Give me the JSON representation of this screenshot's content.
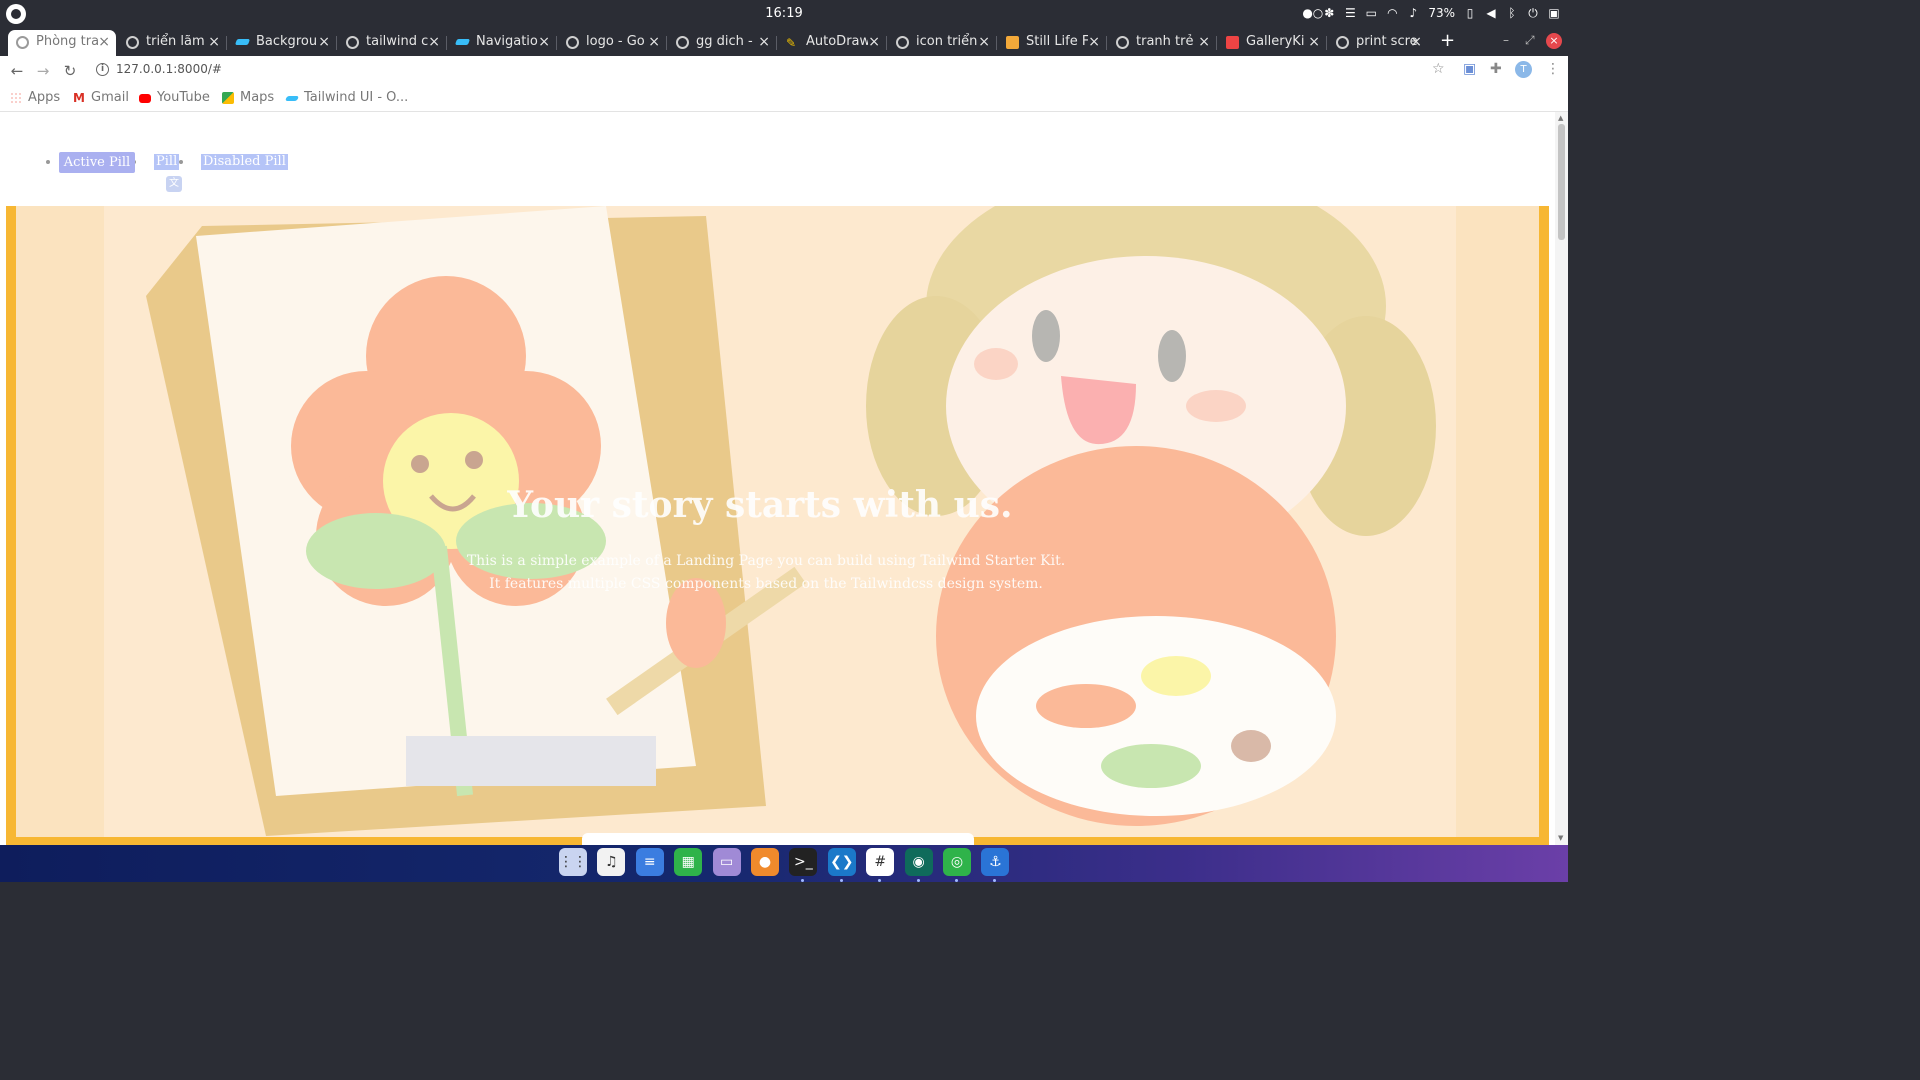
{
  "system_bar": {
    "clock": "16:19",
    "battery": "73%"
  },
  "tabs": [
    {
      "title": "Phòng tra",
      "active": true
    },
    {
      "title": "triển lãm",
      "active": false
    },
    {
      "title": "Backgrou",
      "active": false
    },
    {
      "title": "tailwind c",
      "active": false
    },
    {
      "title": "Navigatio",
      "active": false
    },
    {
      "title": "logo - Go",
      "active": false
    },
    {
      "title": "gg dich - ",
      "active": false
    },
    {
      "title": "AutoDraw",
      "active": false
    },
    {
      "title": "icon triển",
      "active": false
    },
    {
      "title": "Still Life F",
      "active": false
    },
    {
      "title": "tranh trẻ",
      "active": false
    },
    {
      "title": "GalleryKi",
      "active": false
    },
    {
      "title": "print scre",
      "active": false
    }
  ],
  "toolbar": {
    "url": "127.0.0.1:8000/#",
    "profile_initial": "T"
  },
  "bookmarks": [
    {
      "label": "Apps",
      "icon": "apps-grid-icon"
    },
    {
      "label": "Gmail",
      "icon": "gmail-icon"
    },
    {
      "label": "YouTube",
      "icon": "youtube-icon"
    },
    {
      "label": "Maps",
      "icon": "maps-icon"
    },
    {
      "label": "Tailwind UI - O...",
      "icon": "tailwind-icon"
    }
  ],
  "pills": {
    "active": "Active Pill",
    "plain": "Pill",
    "disabled": "Disabled Pill"
  },
  "hero": {
    "title": "Your story starts with us.",
    "text_line1": "This is a simple example of a Landing Page you can build using Tailwind Starter Kit. It features",
    "text_line2": "multiple CSS components based on the Tailwindcss design system.",
    "accent_color": "#f7b733"
  },
  "dock": [
    {
      "name": "app-grid-icon",
      "color": "#c9d4f0",
      "glyph": "⋮⋮"
    },
    {
      "name": "music-icon",
      "color": "#f2f2f2",
      "glyph": "♫"
    },
    {
      "name": "text-editor-icon",
      "color": "#3b7de0",
      "glyph": "≡"
    },
    {
      "name": "spreadsheet-icon",
      "color": "#2fb34a",
      "glyph": "▦"
    },
    {
      "name": "files-icon",
      "color": "#a08ad6",
      "glyph": "▭"
    },
    {
      "name": "firefox-icon",
      "color": "#f08a2c",
      "glyph": "●"
    },
    {
      "name": "terminal-icon",
      "color": "#222",
      "glyph": ">_"
    },
    {
      "name": "vscode-icon",
      "color": "#1b79c9",
      "glyph": "❮❯"
    },
    {
      "name": "slack-icon",
      "color": "#ffffff",
      "glyph": "#"
    },
    {
      "name": "gitkraken-icon",
      "color": "#0f6b5b",
      "glyph": "◉"
    },
    {
      "name": "chrome-icon",
      "color": "#2fb34a",
      "glyph": "◎"
    },
    {
      "name": "anchor-icon",
      "color": "#2a74d6",
      "glyph": "⚓"
    }
  ]
}
